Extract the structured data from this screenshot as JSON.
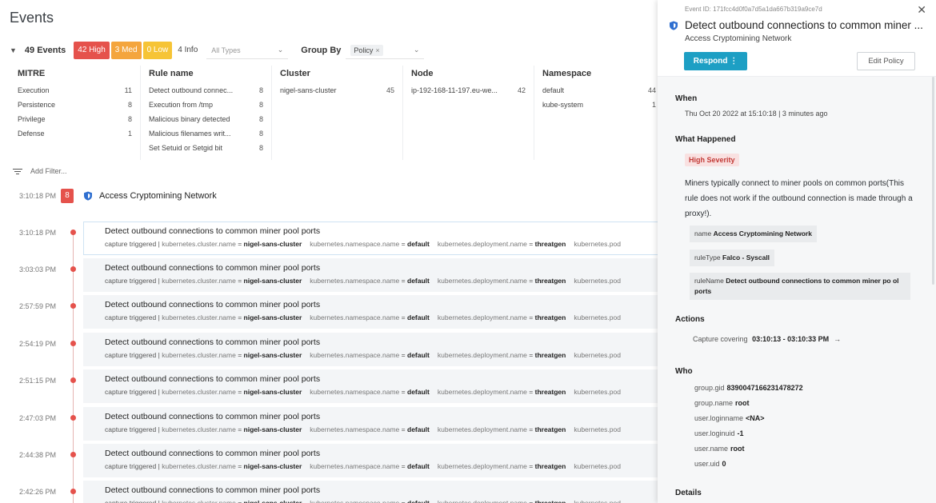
{
  "page": {
    "title": "Events"
  },
  "toolbar": {
    "count": "49 Events",
    "high": "42 High",
    "med": "3 Med",
    "low": "0 Low",
    "info": "4 Info",
    "types_placeholder": "All Types",
    "group_by_label": "Group By",
    "group_by_chip": "Policy"
  },
  "summary": {
    "mitre": {
      "title": "MITRE",
      "rows": [
        {
          "label": "Execution",
          "n": "11"
        },
        {
          "label": "Persistence",
          "n": "8"
        },
        {
          "label": "Privilege",
          "n": "8"
        },
        {
          "label": "Defense",
          "n": "1"
        }
      ]
    },
    "rule": {
      "title": "Rule name",
      "rows": [
        {
          "label": "Detect outbound connec...",
          "n": "8"
        },
        {
          "label": "Execution from /tmp",
          "n": "8"
        },
        {
          "label": "Malicious binary detected",
          "n": "8"
        },
        {
          "label": "Malicious filenames writ...",
          "n": "8"
        },
        {
          "label": "Set Setuid or Setgid bit",
          "n": "8"
        }
      ]
    },
    "cluster": {
      "title": "Cluster",
      "rows": [
        {
          "label": "nigel-sans-cluster",
          "n": "45"
        }
      ]
    },
    "node": {
      "title": "Node",
      "rows": [
        {
          "label": "ip-192-168-11-197.eu-we...",
          "n": "42"
        }
      ]
    },
    "namespace": {
      "title": "Namespace",
      "rows": [
        {
          "label": "default",
          "n": "44"
        },
        {
          "label": "kube-system",
          "n": "1"
        }
      ]
    }
  },
  "filter": {
    "placeholder": "Add Filter..."
  },
  "group": {
    "time": "3:10:18 PM",
    "count": "8",
    "name": "Access Cryptomining Network"
  },
  "event_meta": {
    "prefix": "capture triggered |",
    "k1": "kubernetes.cluster.name",
    "v1": "nigel-sans-cluster",
    "k2": "kubernetes.namespace.name",
    "v2": "default",
    "k3": "kubernetes.deployment.name",
    "v3": "threatgen",
    "k4": "kubernetes.pod",
    "eq": "="
  },
  "events": [
    {
      "time": "3:10:18 PM",
      "title": "Detect outbound connections to common miner pool ports"
    },
    {
      "time": "3:03:03 PM",
      "title": "Detect outbound connections to common miner pool ports"
    },
    {
      "time": "2:57:59 PM",
      "title": "Detect outbound connections to common miner pool ports"
    },
    {
      "time": "2:54:19 PM",
      "title": "Detect outbound connections to common miner pool ports"
    },
    {
      "time": "2:51:15 PM",
      "title": "Detect outbound connections to common miner pool ports"
    },
    {
      "time": "2:47:03 PM",
      "title": "Detect outbound connections to common miner pool ports"
    },
    {
      "time": "2:44:38 PM",
      "title": "Detect outbound connections to common miner pool ports"
    },
    {
      "time": "2:42:26 PM",
      "title": "Detect outbound connections to common miner pool ports"
    }
  ],
  "panel": {
    "event_id": "Event ID: 171fcc4d0f0a7d5a1da667b319a9ce7d",
    "title": "Detect outbound connections to common miner ...",
    "subtitle": "Access Cryptomining Network",
    "respond": "Respond",
    "respond_more": "⋮",
    "edit_policy": "Edit Policy",
    "when_label": "When",
    "when_value": "Thu Oct 20 2022 at 15:10:18 | 3 minutes ago",
    "what_label": "What Happened",
    "severity": "High Severity",
    "description": "Miners typically connect to miner pools on common ports(This rule does not work if the outbound connection is made through a proxy!).",
    "tags": [
      {
        "k": "name",
        "v": "Access Cryptomining Network"
      },
      {
        "k": "ruleType",
        "v": "Falco - Syscall"
      },
      {
        "k": "ruleName",
        "v": "Detect outbound connections to common miner po ol ports"
      }
    ],
    "actions_label": "Actions",
    "capture_label": "Capture covering",
    "capture_range": "03:10:13 - 03:10:33 PM",
    "who_label": "Who",
    "who": [
      {
        "k": "group.gid",
        "v": "8390047166231478272"
      },
      {
        "k": "group.name",
        "v": "root"
      },
      {
        "k": "user.loginname",
        "v": "<NA>"
      },
      {
        "k": "user.loginuid",
        "v": "-1"
      },
      {
        "k": "user.name",
        "v": "root"
      },
      {
        "k": "user.uid",
        "v": "0"
      }
    ],
    "details_label": "Details"
  },
  "colors": {
    "high": "#e5524c",
    "med": "#f4a53d",
    "low": "#f6c436",
    "accent": "#1d9fc4",
    "shield": "#2f6fd0"
  }
}
